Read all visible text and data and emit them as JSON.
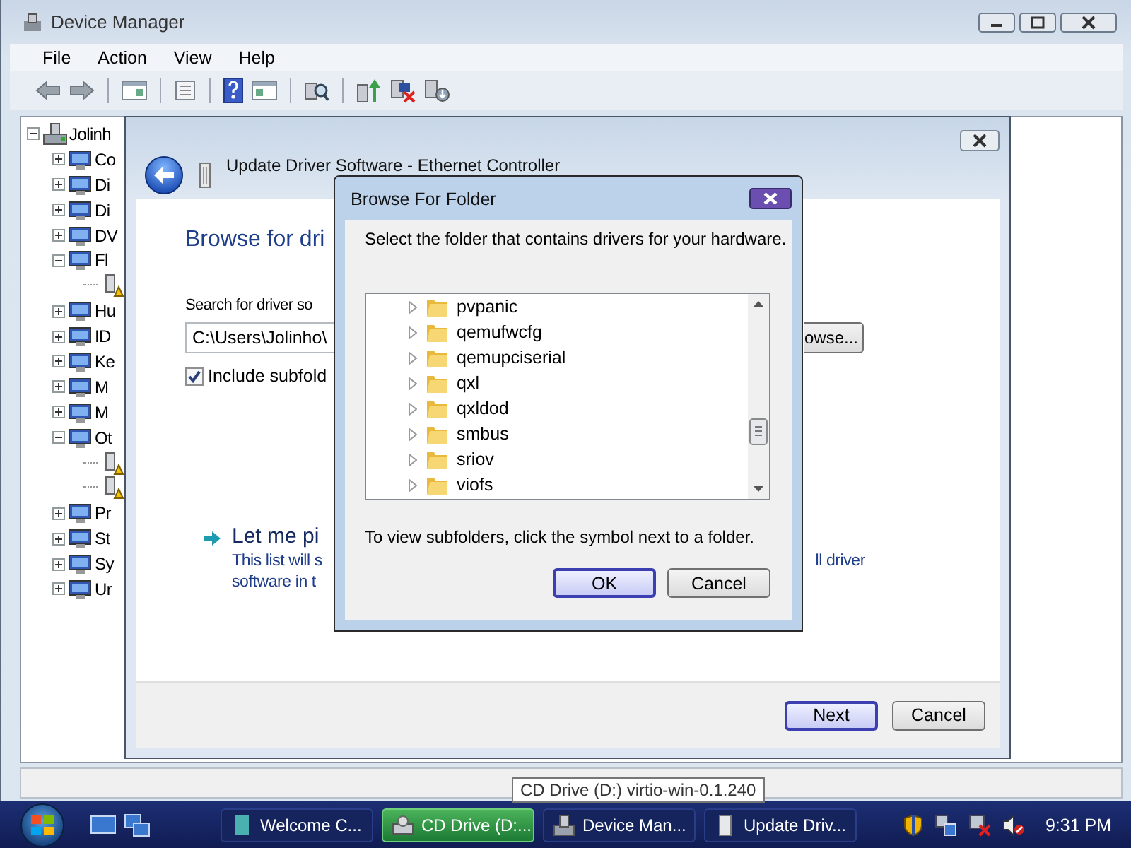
{
  "device_manager": {
    "title": "Device Manager",
    "menu": [
      "File",
      "Action",
      "View",
      "Help"
    ],
    "tree": [
      {
        "label": "Jolinh",
        "kind": "computer",
        "expanded": true,
        "children": [
          {
            "label": "Co",
            "kind": "category",
            "expanded": false
          },
          {
            "label": "Di",
            "kind": "category",
            "expanded": false
          },
          {
            "label": "Di",
            "kind": "category",
            "expanded": false
          },
          {
            "label": "DV",
            "kind": "category",
            "expanded": false
          },
          {
            "label": "Fl",
            "kind": "category",
            "expanded": true,
            "children": [
              {
                "kind": "warning"
              }
            ]
          },
          {
            "label": "Hu",
            "kind": "category",
            "expanded": false
          },
          {
            "label": "ID",
            "kind": "category",
            "expanded": false
          },
          {
            "label": "Ke",
            "kind": "category",
            "expanded": false
          },
          {
            "label": "M",
            "kind": "category",
            "expanded": false
          },
          {
            "label": "M",
            "kind": "category",
            "expanded": false
          },
          {
            "label": "Ot",
            "kind": "category",
            "expanded": true,
            "children": [
              {
                "kind": "warning"
              },
              {
                "kind": "warning"
              }
            ]
          },
          {
            "label": "Pr",
            "kind": "category",
            "expanded": false
          },
          {
            "label": "St",
            "kind": "category",
            "expanded": false
          },
          {
            "label": "Sy",
            "kind": "category",
            "expanded": false
          },
          {
            "label": "Ur",
            "kind": "category",
            "expanded": false
          }
        ]
      }
    ]
  },
  "wizard": {
    "title": "Update Driver Software - Ethernet Controller",
    "heading": "Browse for dri",
    "search_label": "Search for driver so",
    "path": "C:\\Users\\Jolinho\\",
    "browse_button": "owse...",
    "include_subfolders": {
      "label": "Include subfold",
      "checked": true
    },
    "pick_link": "Let me pi",
    "pick_desc_1": "This list will s",
    "pick_desc_1_end": "ll driver",
    "pick_desc_2": "software in t",
    "buttons": [
      "Next",
      "Cancel"
    ]
  },
  "browse_dialog": {
    "title": "Browse For Folder",
    "instruction": "Select the folder that contains drivers for your hardware.",
    "folders": [
      {
        "name": "pvpanic"
      },
      {
        "name": "qemufwcfg"
      },
      {
        "name": "qemupciserial"
      },
      {
        "name": "qxl"
      },
      {
        "name": "qxldod"
      },
      {
        "name": "smbus"
      },
      {
        "name": "sriov"
      },
      {
        "name": "viofs"
      }
    ],
    "hint": "To view subfolders, click the symbol next to a folder.",
    "buttons": [
      "OK",
      "Cancel"
    ]
  },
  "taskbar": {
    "tasks": [
      {
        "label": "Welcome C...",
        "selected": false
      },
      {
        "label": "CD Drive (D:...",
        "selected": true
      },
      {
        "label": "Device Man...",
        "selected": false
      },
      {
        "label": "Update Driv...",
        "selected": false
      }
    ],
    "clock": "9:31 PM"
  },
  "tooltip": "CD Drive (D:) virtio-win-0.1.240"
}
